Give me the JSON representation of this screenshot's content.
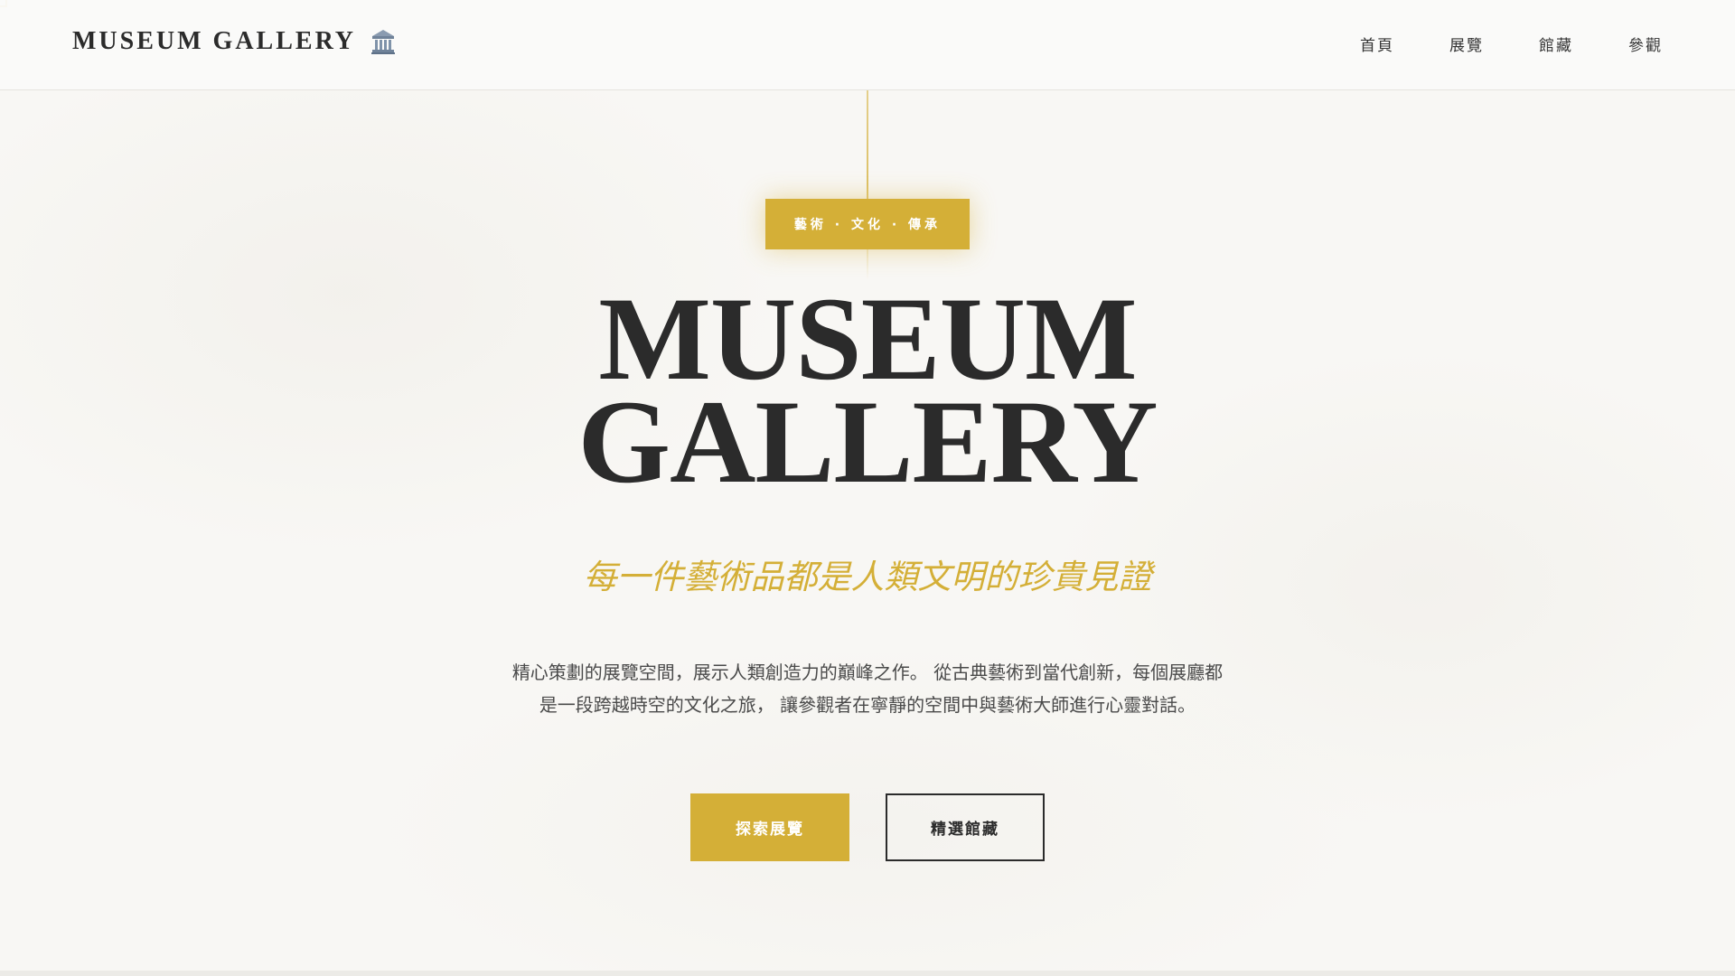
{
  "header": {
    "brand": "MUSEUM GALLERY",
    "brand_icon": "classical-building-icon",
    "nav": [
      "首頁",
      "展覽",
      "館藏",
      "參觀"
    ]
  },
  "hero": {
    "tag": "藝術 · 文化 · 傳承",
    "title_line1": "MUSEUM",
    "title_line2": "GALLERY",
    "subtitle": "每一件藝術品都是人類文明的珍貴見證",
    "description_line1": "精心策劃的展覽空間，展示人類創造力的巔峰之作。 從古典藝術到當代創新，每個展廳都",
    "description_line2": "是一段跨越時空的文化之旅， 讓參觀者在寧靜的空間中與藝術大師進行心靈對話。",
    "primary_button": "探索展覽",
    "secondary_button": "精選館藏"
  },
  "colors": {
    "accent": "#d4af37",
    "text": "#2b2b2b",
    "background": "#f8f7f4"
  }
}
